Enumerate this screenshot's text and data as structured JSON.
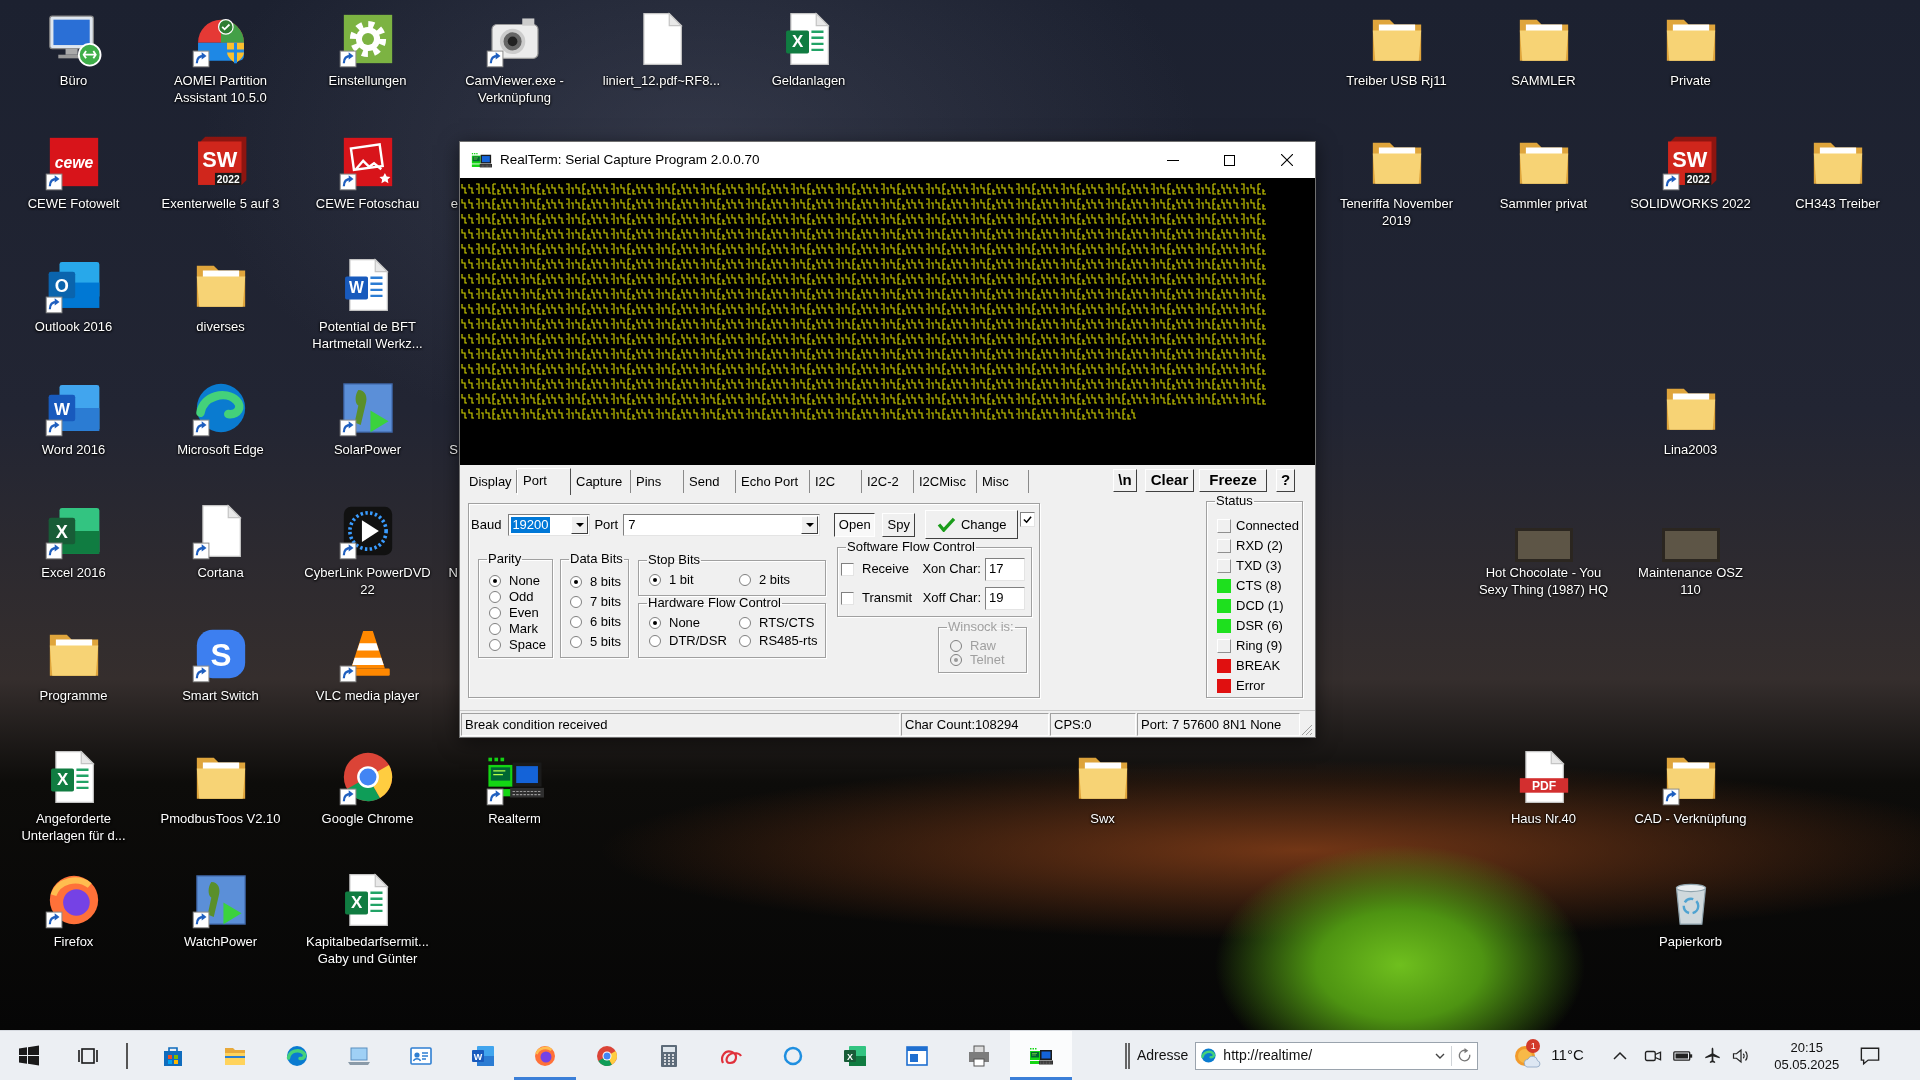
{
  "desktop": {
    "icons": [
      {
        "label": "Büro",
        "kind": "remote",
        "shortcut": false
      },
      {
        "label": "AOMEI Partition\nAssistant 10.5.0",
        "kind": "aomei",
        "shortcut": true
      },
      {
        "label": "Einstellungen",
        "kind": "settings",
        "shortcut": true
      },
      {
        "label": "CamViewer.exe -\nVerknüpfung",
        "kind": "camera",
        "shortcut": true
      },
      {
        "label": "liniert_12.pdf~RF8...",
        "kind": "file",
        "shortcut": false
      },
      {
        "label": "Geldanlagen",
        "kind": "excel-file",
        "shortcut": false,
        "logo_text": "X"
      },
      {
        "label": "Treiber USB Rj11",
        "kind": "folder",
        "shortcut": false
      },
      {
        "label": "SAMMLER",
        "kind": "folder",
        "shortcut": false
      },
      {
        "label": "Private",
        "kind": "folder",
        "shortcut": false
      },
      {
        "label": "CEWE Fotowelt",
        "kind": "cewe",
        "shortcut": true,
        "logo_text": "cewe"
      },
      {
        "label": "Exenterwelle 5 auf 3",
        "kind": "solidworks",
        "shortcut": false,
        "logo_text": "SW",
        "logo_subtext": "2022"
      },
      {
        "label": "CEWE Fotoschau",
        "kind": "photo-app",
        "shortcut": true
      },
      {
        "label": "e",
        "kind": "covered"
      },
      {
        "label": "Teneriffa November\n2019",
        "kind": "folder",
        "shortcut": false
      },
      {
        "label": "Sammler privat",
        "kind": "folder",
        "shortcut": false
      },
      {
        "label": "SOLIDWORKS 2022",
        "kind": "solidworks",
        "shortcut": true,
        "logo_text": "SW",
        "logo_subtext": "2022"
      },
      {
        "label": "CH343 Treiber",
        "kind": "folder",
        "shortcut": false
      },
      {
        "label": "Outlook 2016",
        "kind": "outlook",
        "shortcut": true,
        "logo_text": "O"
      },
      {
        "label": "diverses",
        "kind": "folder",
        "shortcut": false
      },
      {
        "label": "Potential de BFT\nHartmetall Werkz...",
        "kind": "word-file",
        "shortcut": false,
        "logo_text": "W"
      },
      {
        "label": "Word 2016",
        "kind": "word-app",
        "shortcut": true,
        "logo_text": "W"
      },
      {
        "label": "Microsoft Edge",
        "kind": "edge",
        "shortcut": true
      },
      {
        "label": "SolarPower",
        "kind": "solar",
        "shortcut": true
      },
      {
        "label": "S",
        "kind": "covered"
      },
      {
        "label": "Lina2003",
        "kind": "folder",
        "shortcut": false
      },
      {
        "label": "Excel 2016",
        "kind": "excel-app",
        "shortcut": true,
        "logo_text": "X"
      },
      {
        "label": "Cortana",
        "kind": "file",
        "shortcut": true
      },
      {
        "label": "CyberLink PowerDVD\n22",
        "kind": "player",
        "shortcut": true
      },
      {
        "label": "N",
        "kind": "covered"
      },
      {
        "label": "Hot Chocolate - You\nSexy Thing (1987) HQ",
        "kind": "video",
        "shortcut": false
      },
      {
        "label": "Maintenance OSZ\n110",
        "kind": "video",
        "shortcut": false
      },
      {
        "label": "Programme",
        "kind": "folder",
        "shortcut": false
      },
      {
        "label": "Smart Switch",
        "kind": "smartswitch",
        "shortcut": true,
        "logo_text": "S"
      },
      {
        "label": "VLC media player",
        "kind": "cone",
        "shortcut": true
      },
      {
        "label": "Angeforderte\nUnterlagen für d...",
        "kind": "excel-file",
        "shortcut": false,
        "logo_text": "X"
      },
      {
        "label": "PmodbusToos V2.10",
        "kind": "folder",
        "shortcut": false
      },
      {
        "label": "Google Chrome",
        "kind": "chrome",
        "shortcut": true
      },
      {
        "label": "Realterm",
        "kind": "realterm",
        "shortcut": true
      },
      {
        "label": "Swx",
        "kind": "folder",
        "shortcut": false
      },
      {
        "label": "Haus Nr.40",
        "kind": "pdf",
        "shortcut": false,
        "logo_text": "PDF"
      },
      {
        "label": "CAD - Verknüpfung",
        "kind": "folder",
        "shortcut": true
      },
      {
        "label": "Firefox",
        "kind": "firefox",
        "shortcut": true
      },
      {
        "label": "WatchPower",
        "kind": "solar",
        "shortcut": true
      },
      {
        "label": "Kapitalbedarfsermit...\nGaby und Günter",
        "kind": "excel-file",
        "shortcut": false,
        "logo_text": "X"
      },
      {
        "label": "Papierkorb",
        "kind": "recycle",
        "shortcut": false
      }
    ]
  },
  "window": {
    "title": "RealTerm: Serial Capture Program 2.0.0.70",
    "tabs": [
      {
        "label": "Display",
        "selected": false
      },
      {
        "label": "Port",
        "selected": true
      },
      {
        "label": "Capture",
        "selected": false
      },
      {
        "label": "Pins",
        "selected": false
      },
      {
        "label": "Send",
        "selected": false
      },
      {
        "label": "Echo Port",
        "selected": false
      },
      {
        "label": "I2C",
        "selected": false
      },
      {
        "label": "I2C-2",
        "selected": false
      },
      {
        "label": "I2CMisc",
        "selected": false
      },
      {
        "label": "Misc",
        "selected": false
      }
    ],
    "toolbar_buttons": [
      "\\n",
      "Clear",
      "Freeze",
      "?"
    ],
    "port_panel": {
      "baud": {
        "label": "Baud",
        "value": "19200",
        "focused": true
      },
      "port": {
        "label": "Port",
        "value": "7",
        "focused": false
      },
      "open_button": {
        "label": "Open",
        "pressed": true
      },
      "spy_button": {
        "label": "Spy",
        "pressed": false
      },
      "change_button": {
        "label": "Change"
      },
      "change_checkbox": {
        "checked": true
      },
      "parity": {
        "title": "Parity",
        "options": [
          {
            "label": "None",
            "selected": true
          },
          {
            "label": "Odd",
            "selected": false
          },
          {
            "label": "Even",
            "selected": false
          },
          {
            "label": "Mark",
            "selected": false
          },
          {
            "label": "Space",
            "selected": false
          }
        ]
      },
      "data_bits": {
        "title": "Data Bits",
        "options": [
          {
            "label": "8 bits",
            "selected": true
          },
          {
            "label": "7 bits",
            "selected": false
          },
          {
            "label": "6 bits",
            "selected": false
          },
          {
            "label": "5 bits",
            "selected": false
          }
        ]
      },
      "stop_bits": {
        "title": "Stop Bits",
        "options": [
          {
            "label": "1 bit",
            "selected": true
          },
          {
            "label": "2 bits",
            "selected": false
          }
        ]
      },
      "hardware_flow": {
        "title": "Hardware Flow Control",
        "options": [
          {
            "label": "None",
            "selected": true
          },
          {
            "label": "RTS/CTS",
            "selected": false
          },
          {
            "label": "DTR/DSR",
            "selected": false
          },
          {
            "label": "RS485-rts",
            "selected": false
          }
        ]
      },
      "software_flow": {
        "title": "Software Flow Control",
        "rows": [
          {
            "label": "Receive",
            "checked": false,
            "char_label": "Xon Char:",
            "char_value": "17"
          },
          {
            "label": "Transmit",
            "checked": false,
            "char_label": "Xoff Char:",
            "char_value": "19"
          }
        ]
      },
      "winsock": {
        "title": "Winsock is:",
        "disabled": true,
        "options": [
          {
            "label": "Raw",
            "selected": false
          },
          {
            "label": "Telnet",
            "selected": true
          }
        ]
      }
    },
    "status": {
      "title": "Status",
      "items": [
        {
          "label": "Connected",
          "lit": false
        },
        {
          "label": "RXD (2)",
          "lit": false
        },
        {
          "label": "TXD (3)",
          "lit": false
        },
        {
          "label": "CTS (8)",
          "lit": true,
          "color": "#1ee01e"
        },
        {
          "label": "DCD (1)",
          "lit": true,
          "color": "#1ee01e"
        },
        {
          "label": "DSR (6)",
          "lit": true,
          "color": "#1ee01e"
        },
        {
          "label": "Ring (9)",
          "lit": false
        },
        {
          "label": "BREAK",
          "lit": true,
          "color": "#e01010"
        },
        {
          "label": "Error",
          "lit": true,
          "color": "#e01010"
        }
      ]
    },
    "status_bar": [
      "Break condition received",
      "Char Count:108294",
      "CPS:0",
      "Port: 7 57600 8N1 None"
    ]
  },
  "taskbar": {
    "apps": [
      {
        "kind": "start",
        "running": false,
        "active": false
      },
      {
        "kind": "taskview",
        "running": false,
        "active": false
      },
      {
        "kind": "store",
        "running": false,
        "active": false
      },
      {
        "kind": "explorer",
        "running": false,
        "active": false
      },
      {
        "kind": "edge",
        "running": false,
        "active": false
      },
      {
        "kind": "laptop",
        "running": false,
        "active": false
      },
      {
        "kind": "contacts",
        "running": false,
        "active": false
      },
      {
        "kind": "word",
        "running": false,
        "active": false,
        "logo_text": "W"
      },
      {
        "kind": "firefox",
        "running": true,
        "active": false
      },
      {
        "kind": "chrome",
        "running": false,
        "active": false
      },
      {
        "kind": "calculator",
        "running": false,
        "active": false
      },
      {
        "kind": "snip",
        "running": false,
        "active": false
      },
      {
        "kind": "cortana",
        "running": false,
        "active": false
      },
      {
        "kind": "excel",
        "running": false,
        "active": false,
        "logo_text": "X"
      },
      {
        "kind": "window",
        "running": false,
        "active": false
      },
      {
        "kind": "device",
        "running": false,
        "active": false
      },
      {
        "kind": "realterm",
        "running": true,
        "active": true
      }
    ],
    "address": {
      "label": "Adresse",
      "value": "http://realtime/"
    },
    "weather": {
      "alert_count": "1",
      "temperature": "11°C"
    },
    "clock": {
      "time": "20:15",
      "date": "05.05.2025"
    }
  }
}
